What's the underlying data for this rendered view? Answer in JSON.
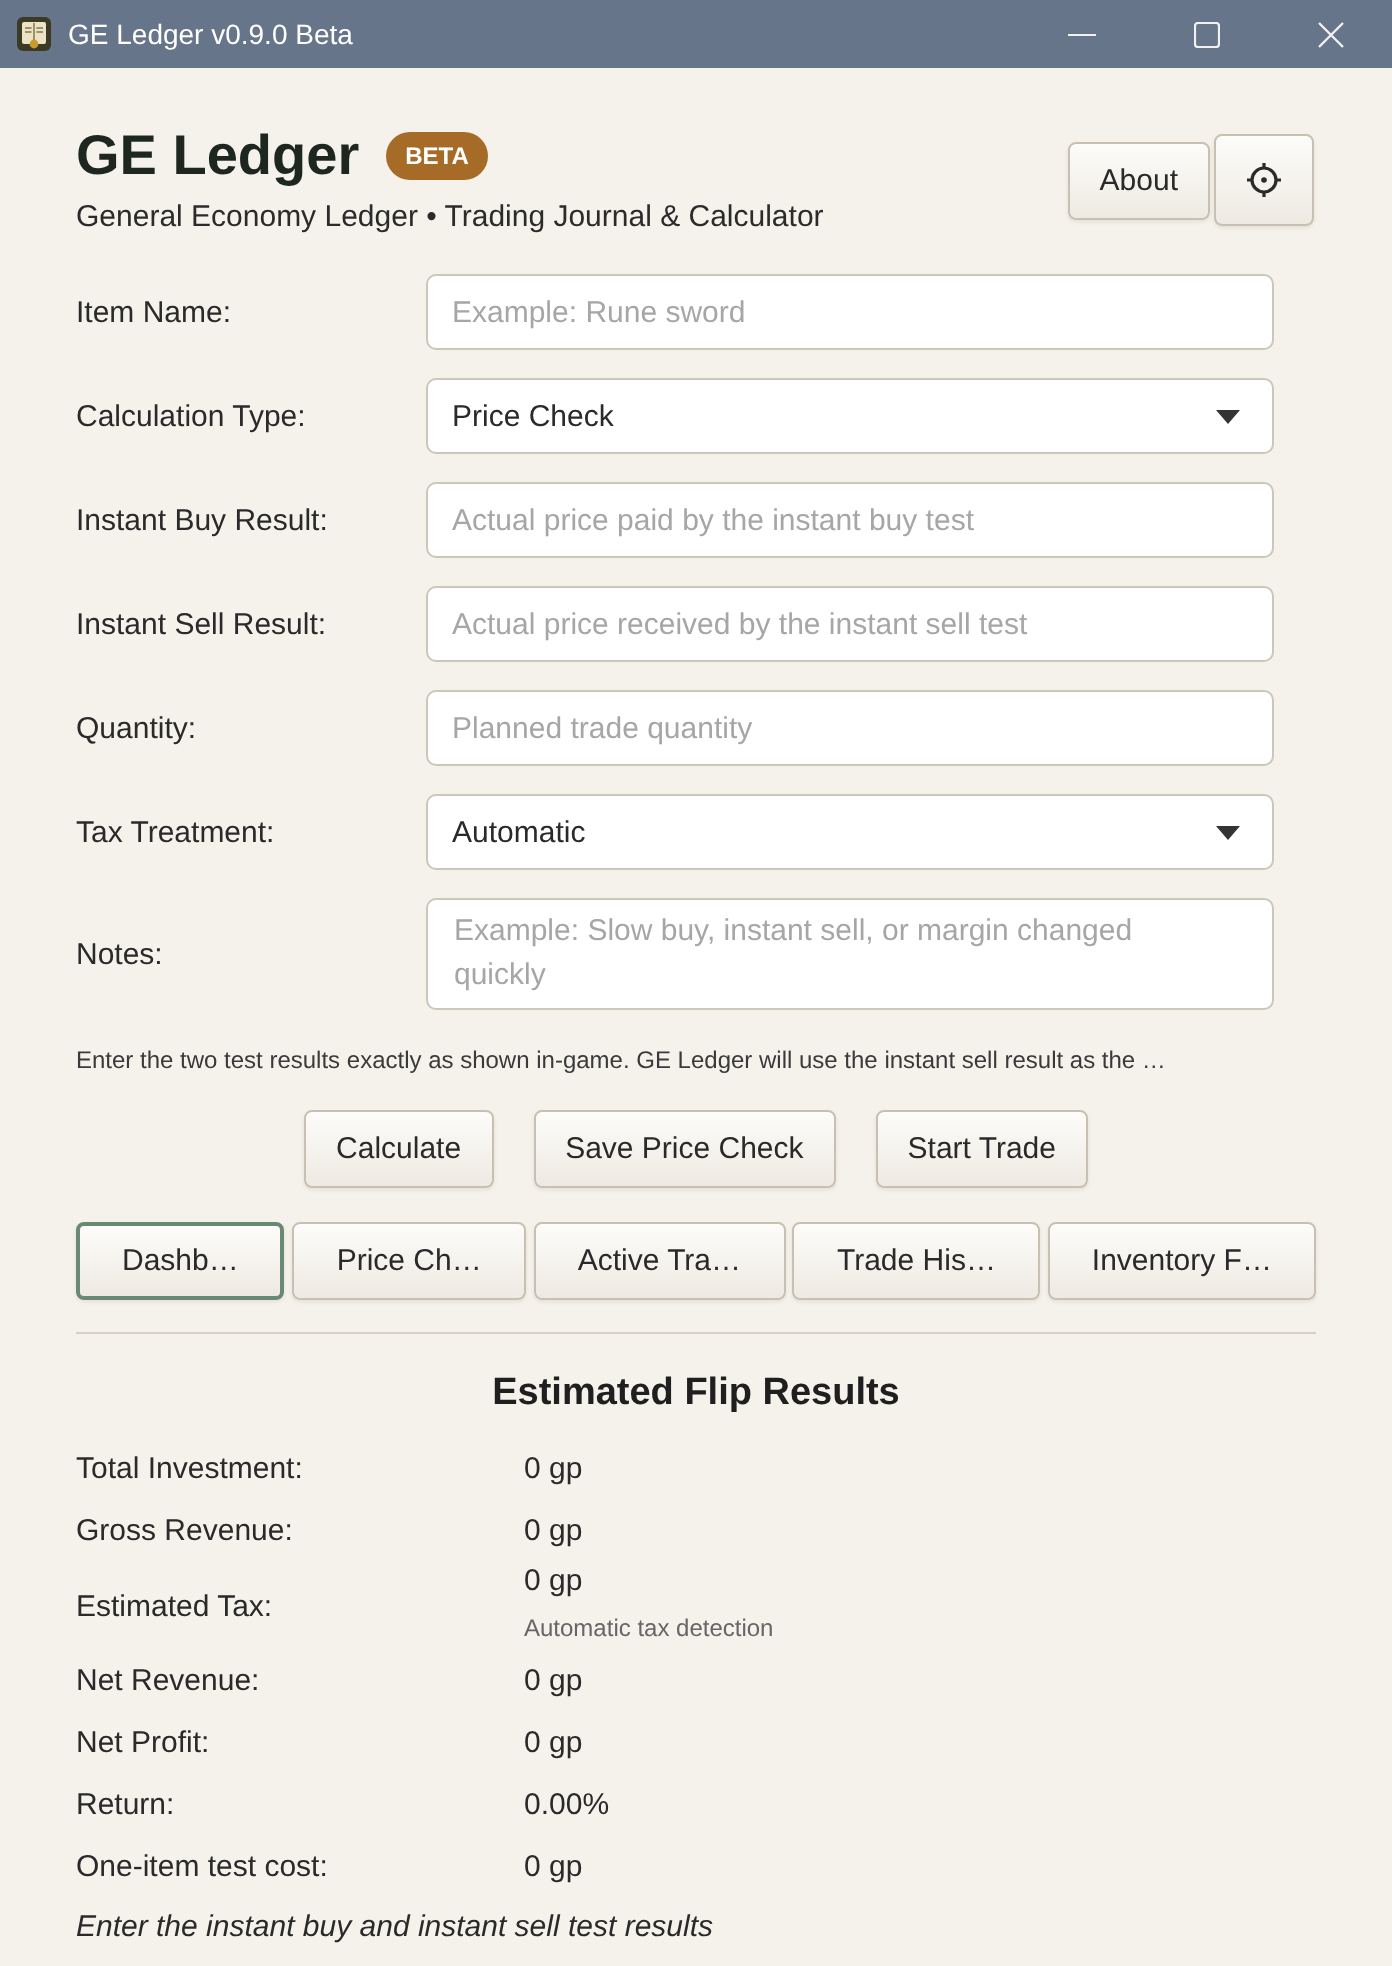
{
  "window": {
    "title": "GE Ledger v0.9.0 Beta"
  },
  "header": {
    "title": "GE Ledger",
    "badge": "BETA",
    "subtitle": "General Economy Ledger • Trading Journal & Calculator",
    "about_button": "About"
  },
  "form": {
    "fields": [
      {
        "label": "Item Name:",
        "kind": "text",
        "placeholder": "Example: Rune sword"
      },
      {
        "label": "Calculation Type:",
        "kind": "dropdown",
        "value": "Price Check"
      },
      {
        "label": "Instant Buy Result:",
        "kind": "text",
        "placeholder": "Actual price paid by the instant buy test"
      },
      {
        "label": "Instant Sell Result:",
        "kind": "text",
        "placeholder": "Actual price received by the instant sell test"
      },
      {
        "label": "Quantity:",
        "kind": "text",
        "placeholder": "Planned trade quantity"
      },
      {
        "label": "Tax Treatment:",
        "kind": "dropdown",
        "value": "Automatic"
      },
      {
        "label": "Notes:",
        "kind": "textarea",
        "placeholder": "Example: Slow buy, instant sell, or margin changed quickly"
      }
    ],
    "hint": "Enter the two test results exactly as shown in-game. GE Ledger will use the instant sell result as the …"
  },
  "actions": [
    "Calculate",
    "Save Price Check",
    "Start Trade"
  ],
  "nav_tabs": [
    {
      "label": "Dashb…",
      "selected": true
    },
    {
      "label": "Price Ch…",
      "selected": false
    },
    {
      "label": "Active Tra…",
      "selected": false
    },
    {
      "label": "Trade His…",
      "selected": false
    },
    {
      "label": "Inventory F…",
      "selected": false
    }
  ],
  "results": {
    "title": "Estimated Flip Results",
    "rows": [
      {
        "label": "Total Investment:",
        "value": "0 gp"
      },
      {
        "label": "Gross Revenue:",
        "value": "0 gp"
      },
      {
        "label": "Estimated Tax:",
        "value": "0 gp",
        "note": "Automatic tax detection"
      },
      {
        "label": "Net Revenue:",
        "value": "0 gp"
      },
      {
        "label": "Net Profit:",
        "value": "0 gp"
      },
      {
        "label": "Return:",
        "value": "0.00%"
      },
      {
        "label": "One-item test cost:",
        "value": "0 gp"
      }
    ],
    "footer": "Enter the instant buy and instant sell test results"
  }
}
